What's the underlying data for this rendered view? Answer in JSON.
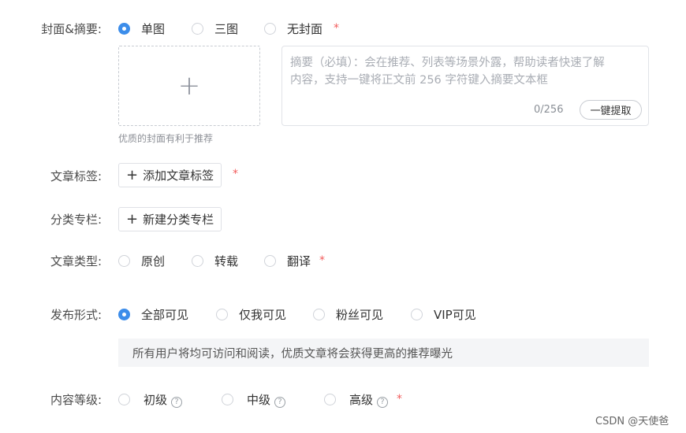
{
  "cover": {
    "label": "封面&摘要:",
    "options": [
      "单图",
      "三图",
      "无封面"
    ],
    "selected": "单图",
    "upload_plus": "+",
    "hint": "优质的封面有利于推荐"
  },
  "abstract": {
    "placeholder": "摘要（必填）：会在推荐、列表等场景外露，帮助读者快速了解\n内容，支持一键将正文前 256 字符键入摘要文本框",
    "count": "0/256",
    "extract_label": "一键提取"
  },
  "tags": {
    "label": "文章标签:",
    "add_label": "添加文章标签"
  },
  "column": {
    "label": "分类专栏:",
    "add_label": "新建分类专栏"
  },
  "article_type": {
    "label": "文章类型:",
    "options": [
      "原创",
      "转载",
      "翻译"
    ]
  },
  "visibility": {
    "label": "发布形式:",
    "options": [
      "全部可见",
      "仅我可见",
      "粉丝可见",
      "VIP可见"
    ],
    "selected": "全部可见",
    "info": "所有用户将均可访问和阅读，优质文章将会获得更高的推荐曝光"
  },
  "level": {
    "label": "内容等级:",
    "options": [
      "初级",
      "中级",
      "高级"
    ],
    "help_glyph": "?"
  },
  "required_mark": "*",
  "plus_glyph": "+",
  "watermark": "CSDN @天使爸",
  "colors": {
    "accent": "#3c8dea",
    "required": "#f25c5c"
  }
}
